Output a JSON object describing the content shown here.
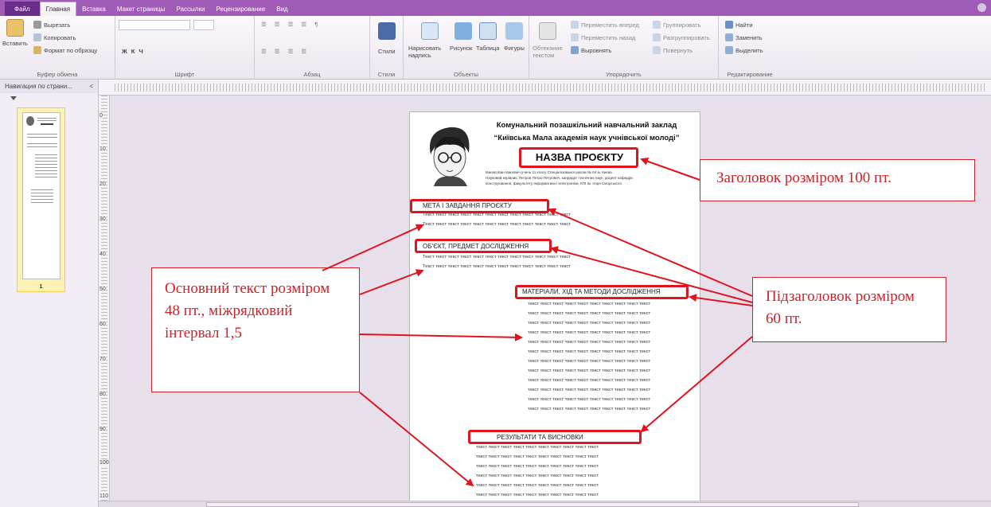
{
  "tabs": {
    "file": "Файл",
    "items": [
      "Главная",
      "Вставка",
      "Макет страницы",
      "Рассылки",
      "Рецензирование",
      "Вид"
    ]
  },
  "ribbon": {
    "clipboard": {
      "paste": "Вставить",
      "cut": "Вырезать",
      "copy": "Копировать",
      "format_painter": "Формат по образцу",
      "label": "Буфер обмена"
    },
    "font": {
      "label": "Шрифт"
    },
    "paragraph": {
      "label": "Абзац"
    },
    "styles": {
      "button": "Стили",
      "label": "Стили"
    },
    "objects": {
      "draw_text_box": "Нарисовать надпись",
      "picture": "Рисунок",
      "table": "Таблица",
      "shapes": "Фигуры",
      "label": "Объекты"
    },
    "arrange": {
      "wrap_text": "Обтекание текстом",
      "bring_forward": "Переместить вперед",
      "send_backward": "Переместить назад",
      "align": "Выровнять",
      "group": "Группировать",
      "ungroup": "Разгруппировать",
      "rotate": "Повернуть",
      "label": "Упорядочить"
    },
    "editing": {
      "find": "Найти",
      "replace": "Заменить",
      "select": "Выделить",
      "label": "Редактирование"
    }
  },
  "nav": {
    "title": "Навигация по страни...",
    "close": "<",
    "page_number": "1"
  },
  "ruler": {
    "v_numbers": [
      "0",
      "10",
      "20",
      "30",
      "40",
      "50",
      "60",
      "70",
      "80",
      "90",
      "100",
      "110"
    ]
  },
  "doc": {
    "institution_line1": "Комунальний позашкільний навчальний заклад",
    "institution_line2": "“Київська Мала академія наук учнівської молоді”",
    "project_title": "НАЗВА ПРОЄКТУ",
    "author_line1": "Іванов Іван Іванович учень 11 класу Спеціалізованої школи № 64 м. Києва",
    "author_line2": "Науковий керівник: Петров Петро Петрович, кандидат технічних наук, доцент кафедри",
    "author_line3": "конструювання, факультету Інформатики і електроніки, КПІ ім. Ігоря Сікорського.",
    "section1": "МЕТА І ЗАВДАННЯ ПРОЄКТУ",
    "section2": "ОБ’ЄКТ, ПРЕДМЕТ ДОСЛІДЖЕННЯ",
    "section3": "МАТЕРІАЛИ, ХІД ТА МЕТОДИ ДОСЛІДЖЕННЯ",
    "section4": "РЕЗУЛЬТАТИ ТА ВИСНОВКИ",
    "body_line": "Текст текст текст текст текст текст текст текст текст текст текст текст",
    "body_line_short": "текст текст текст текст текст текст текст текст текст текст"
  },
  "callouts": {
    "title": "Заголовок розміром 100 пт.",
    "subtitle": "Підзаголовок розміром 60 пт.",
    "body": "Основний текст розміром 48 пт., міжрядковий інтервал 1,5"
  },
  "colors": {
    "accent": "#e0141e",
    "ribbon_tab": "#a05bb6"
  }
}
